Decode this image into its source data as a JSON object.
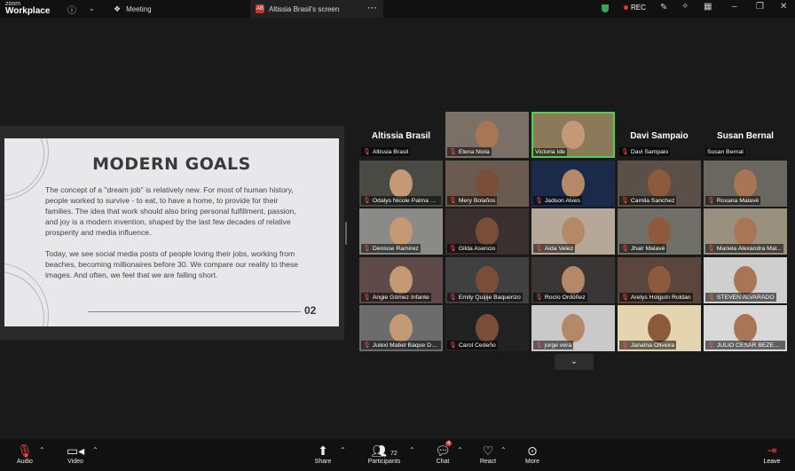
{
  "app": {
    "logo_line1": "zoom",
    "logo_line2": "Workplace"
  },
  "topbar": {
    "meeting_tab": "Meeting",
    "screen_tab_badge": "AB",
    "screen_tab": "Altissia Brasil's screen",
    "rec_label": "REC"
  },
  "slide": {
    "title": "MODERN GOALS",
    "para1": "The concept of a \"dream job\" is relatively new. For most of human history, people worked to survive - to eat, to have a home, to provide for their families. The idea that work should also bring personal fulfillment, passion, and joy is a modern invention, shaped by the last few decades of relative prosperity and media influence.",
    "para2": "Today, we see social media posts of people loving their jobs, working from beaches, becoming millionaires before 30. We compare our reality to these images. And often, we feel that we are falling short.",
    "number": "02"
  },
  "gallery": {
    "row0": [
      {
        "big": "Altissia Brasil",
        "cap": "Altissia Brasil",
        "muted": true
      },
      {
        "cap": "Elena Niola",
        "muted": true
      },
      {
        "cap": "Victoria Ide",
        "muted": false
      },
      {
        "big": "Davi Sampaio",
        "cap": "Davi Sampaio",
        "muted": true
      },
      {
        "big": "Susan Bernal",
        "cap": "Susan Bernal",
        "muted": false
      }
    ],
    "tiles": [
      {
        "cap": "Odalys Nicole Palma C...",
        "muted": true
      },
      {
        "cap": "Mery Bolaños",
        "muted": true
      },
      {
        "cap": "Jadson Alves",
        "muted": true
      },
      {
        "cap": "Camila Sanchez",
        "muted": true
      },
      {
        "cap": "Roxana Malavé",
        "muted": true
      },
      {
        "cap": "Denisse Ramirez",
        "muted": true
      },
      {
        "cap": "Gilda Asencio",
        "muted": true
      },
      {
        "cap": "Aida Velez",
        "muted": true
      },
      {
        "cap": "Jhair Malavé",
        "muted": true
      },
      {
        "cap": "Mariela Alexandra Mal...",
        "muted": true
      },
      {
        "cap": "Angie Gómez Infante",
        "muted": true
      },
      {
        "cap": "Emily Quijije Baquerizo",
        "muted": true
      },
      {
        "cap": "Rocío Ordóñez",
        "muted": true
      },
      {
        "cap": "Arelys Holguín Roldan",
        "muted": true
      },
      {
        "cap": "STEVEN ALVARADO",
        "muted": true
      },
      {
        "cap": "Julexi Mabel Baque De...",
        "muted": true
      },
      {
        "cap": "Carol Cedeño",
        "muted": true
      },
      {
        "cap": "jorge vera",
        "muted": true
      },
      {
        "cap": "Janaína Oliveira",
        "muted": true
      },
      {
        "cap": "JULIO CESAR BEZERRA...",
        "muted": true
      }
    ]
  },
  "toolbar": {
    "audio": "Audio",
    "video": "Video",
    "share": "Share",
    "participants_count": "72",
    "participants": "Participants",
    "chat_badge": "4",
    "chat": "Chat",
    "react": "React",
    "more": "More",
    "leave": "Leave"
  },
  "colors": {
    "active_speaker": "#4ecf4e",
    "muted": "#ff4d4d",
    "rec": "#e53935",
    "shield": "#3aa657"
  }
}
